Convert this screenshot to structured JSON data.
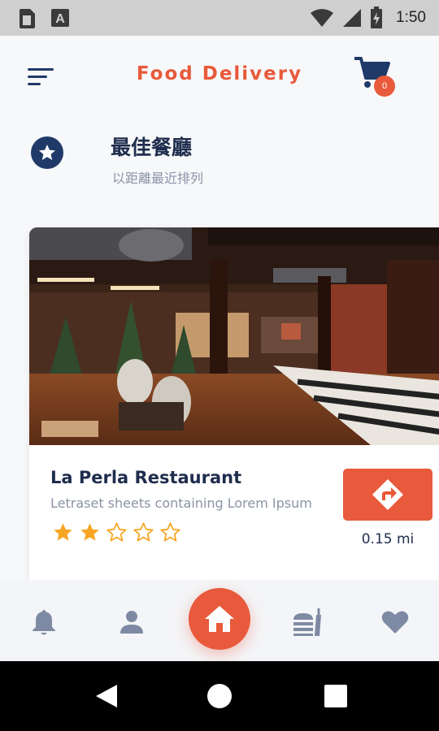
{
  "status_bar": {
    "time": "1:50",
    "icons": [
      "sim-card-icon",
      "keyboard-a-icon",
      "wifi-icon",
      "signal-icon",
      "battery-charging-icon"
    ]
  },
  "app_bar": {
    "title": "Food Delivery",
    "cart_count": "0",
    "icons": [
      "menu-icon",
      "cart-icon"
    ]
  },
  "section": {
    "title": "最佳餐廳",
    "subtitle": "以距離最近排列",
    "icon": "star-icon"
  },
  "restaurant": {
    "name": "La Perla Restaurant",
    "description": "Letraset sheets containing Lorem Ipsum",
    "rating": 2,
    "rating_max": 5,
    "distance": "0.15 mi",
    "photo": "restaurant-interior-photo",
    "direction_icon": "directions-icon"
  },
  "bottom_nav": {
    "items": [
      "bell-icon",
      "user-icon",
      "home-icon",
      "fastfood-icon",
      "heart-icon"
    ],
    "active": "home-icon"
  },
  "colors": {
    "accent": "#e85a3b",
    "navy": "#1f3a68",
    "text": "#1f2d4d",
    "muted": "#8a93a6",
    "nav_icon": "#7e8aa3",
    "star": "#f6a623"
  }
}
